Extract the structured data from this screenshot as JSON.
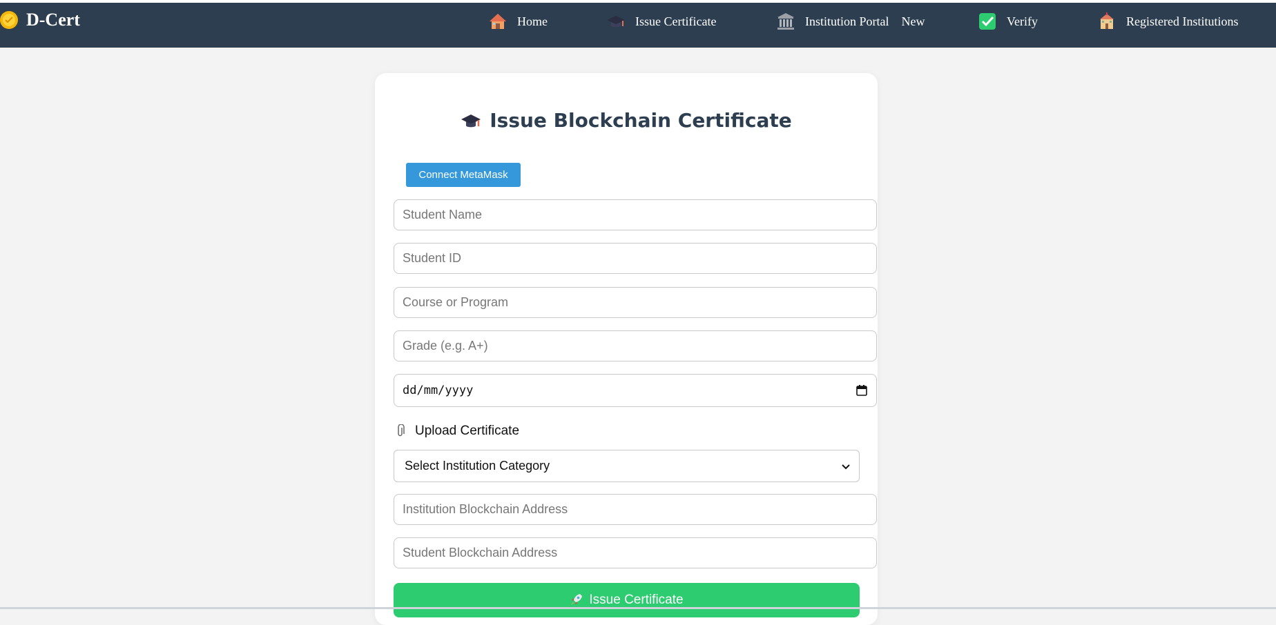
{
  "brand": {
    "name": "D-Cert",
    "icon": "sun-badge-icon"
  },
  "nav": {
    "items": [
      {
        "label": "Home",
        "icon": "house-icon"
      },
      {
        "label": "Issue Certificate",
        "icon": "graduation-cap-icon"
      },
      {
        "label": "Institution Portal",
        "badge": "New",
        "icon": "classical-building-icon"
      },
      {
        "label": "Verify",
        "icon": "check-box-icon"
      },
      {
        "label": "Registered Institutions",
        "icon": "school-icon"
      }
    ]
  },
  "form": {
    "title": "Issue Blockchain Certificate",
    "connect_label": "Connect MetaMask",
    "fields": {
      "student_name": "Student Name",
      "student_id": "Student ID",
      "course": "Course or Program",
      "grade": "Grade (e.g. A+)",
      "date": "dd/mm/yyyy",
      "institution_address": "Institution Blockchain Address",
      "student_address": "Student Blockchain Address"
    },
    "upload_label": "Upload Certificate",
    "select_value": "Select Institution Category",
    "submit_label": "Issue Certificate"
  },
  "colors": {
    "navbar": "#2c3e50",
    "connect_button": "#3498db",
    "submit_button": "#2ecc71"
  }
}
